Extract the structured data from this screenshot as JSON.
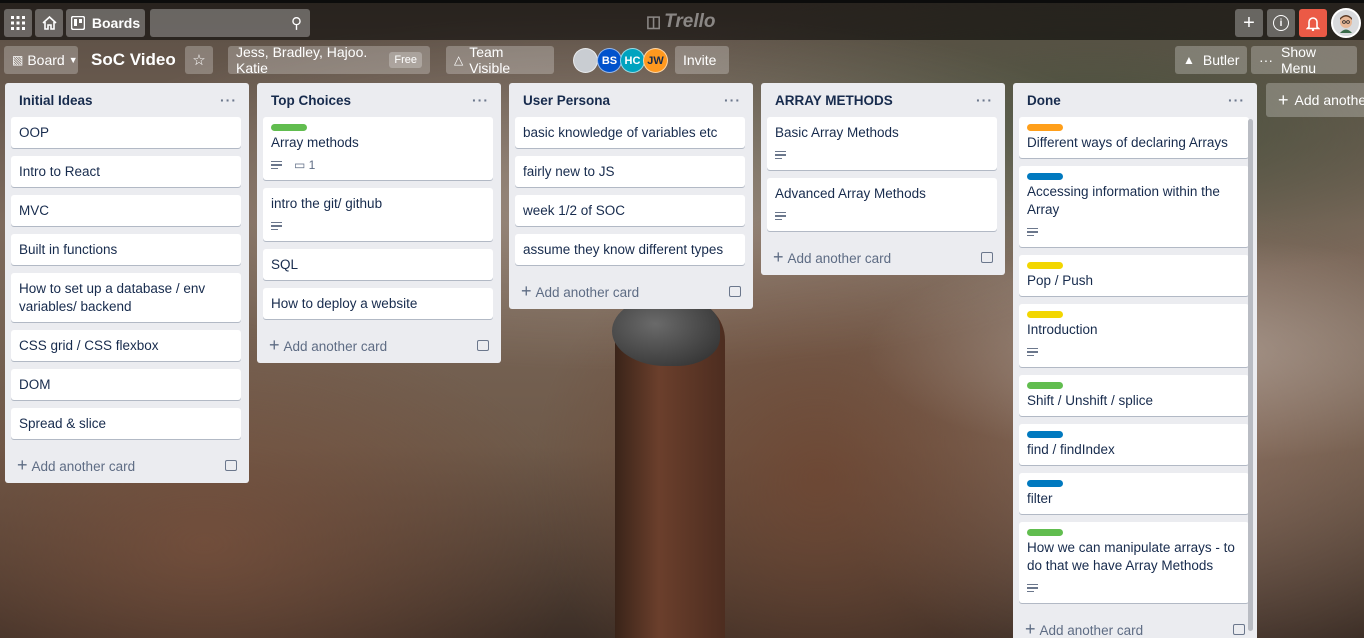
{
  "header": {
    "boards_label": "Boards",
    "logo_text": "Trello"
  },
  "board_header": {
    "view_label": "Board",
    "title": "SoC Video",
    "team_name": "Jess, Bradley, Hajoo. Katie",
    "team_badge": "Free",
    "visibility_label": "Team Visible",
    "members": [
      {
        "initials": "",
        "color": "#c9cdd2"
      },
      {
        "initials": "BS",
        "color": "#0052cc"
      },
      {
        "initials": "HC",
        "color": "#00a3bf"
      },
      {
        "initials": "JW",
        "color": "#ff991f"
      }
    ],
    "invite_label": "Invite",
    "butler_label": "Butler",
    "show_menu_label": "Show Menu"
  },
  "lists": [
    {
      "title": "Initial Ideas",
      "cards": [
        {
          "text": "OOP"
        },
        {
          "text": "Intro to React"
        },
        {
          "text": "MVC"
        },
        {
          "text": "Built in functions"
        },
        {
          "text": "How to set up a database / env variables/ backend"
        },
        {
          "text": "CSS grid / CSS flexbox"
        },
        {
          "text": "DOM"
        },
        {
          "text": "Spread & slice"
        }
      ],
      "add_label": "Add another card"
    },
    {
      "title": "Top Choices",
      "cards": [
        {
          "text": "Array methods",
          "label_color": "#61bd4f",
          "has_description": true,
          "comments": "1"
        },
        {
          "text": "intro the git/ github",
          "has_description": true
        },
        {
          "text": "SQL"
        },
        {
          "text": "How to deploy a website"
        }
      ],
      "add_label": "Add another card"
    },
    {
      "title": "User Persona",
      "cards": [
        {
          "text": "basic knowledge of variables etc"
        },
        {
          "text": "fairly new to JS"
        },
        {
          "text": "week 1/2 of SOC"
        },
        {
          "text": "assume they know different types"
        }
      ],
      "add_label": "Add another card"
    },
    {
      "title": "ARRAY METHODS",
      "cards": [
        {
          "text": "Basic Array Methods",
          "has_description": true
        },
        {
          "text": "Advanced Array Methods",
          "has_description": true
        }
      ],
      "add_label": "Add another card"
    },
    {
      "title": "Done",
      "cards": [
        {
          "text": "Different ways of declaring Arrays",
          "label_color": "#ff9f1a"
        },
        {
          "text": "Accessing information within the Array",
          "label_color": "#0079bf",
          "has_description": true
        },
        {
          "text": "Pop / Push",
          "label_color": "#f2d600"
        },
        {
          "text": "Introduction",
          "label_color": "#f2d600",
          "has_description": true
        },
        {
          "text": "Shift / Unshift / splice",
          "label_color": "#61bd4f"
        },
        {
          "text": "find / findIndex",
          "label_color": "#0079bf"
        },
        {
          "text": "filter",
          "label_color": "#0079bf"
        },
        {
          "text": "How we can manipulate arrays - to do that we have Array Methods",
          "label_color": "#61bd4f",
          "has_description": true
        }
      ],
      "add_label": "Add another card"
    }
  ],
  "add_list_label": "Add another list"
}
